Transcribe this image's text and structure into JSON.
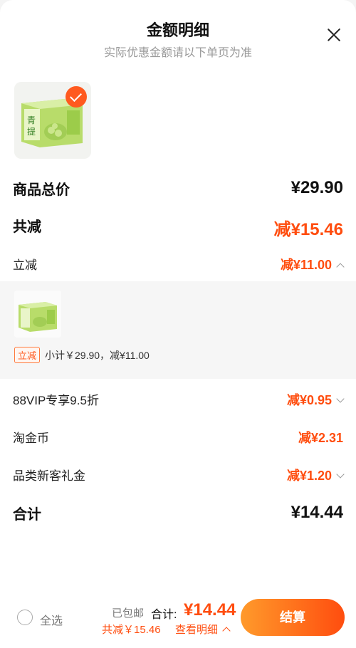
{
  "header": {
    "title": "金额明细",
    "subtitle": "实际优惠金额请以下单页为准"
  },
  "rows": {
    "total_price": {
      "label": "商品总价",
      "amount": "¥29.90"
    },
    "total_reduce": {
      "label": "共减",
      "amount": "减¥15.46"
    },
    "instant_reduce": {
      "label": "立减",
      "amount": "减¥11.00"
    },
    "vip": {
      "label": "88VIP专享9.5折",
      "amount": "减¥0.95"
    },
    "coin": {
      "label": "淘金币",
      "amount": "减¥2.31"
    },
    "newcomer": {
      "label": "品类新客礼金",
      "amount": "减¥1.20"
    },
    "sum": {
      "label": "合计",
      "amount": "¥14.44"
    }
  },
  "detail_panel": {
    "tag": "立减",
    "subtotal": "小计￥29.90，减¥11.00"
  },
  "footer": {
    "select_all": "全选",
    "shipping": "已包邮",
    "total_label": "合计:",
    "total_value": "¥14.44",
    "saved": "共减￥15.46",
    "view_detail": "查看明细",
    "checkout": "结算"
  },
  "colors": {
    "accent": "#ff4d0f",
    "button_start": "#ff9a2b",
    "button_end": "#ff4d0f"
  },
  "icons": [
    "close-icon",
    "check-icon",
    "chevron-up-icon",
    "chevron-down-icon",
    "radio-icon"
  ]
}
